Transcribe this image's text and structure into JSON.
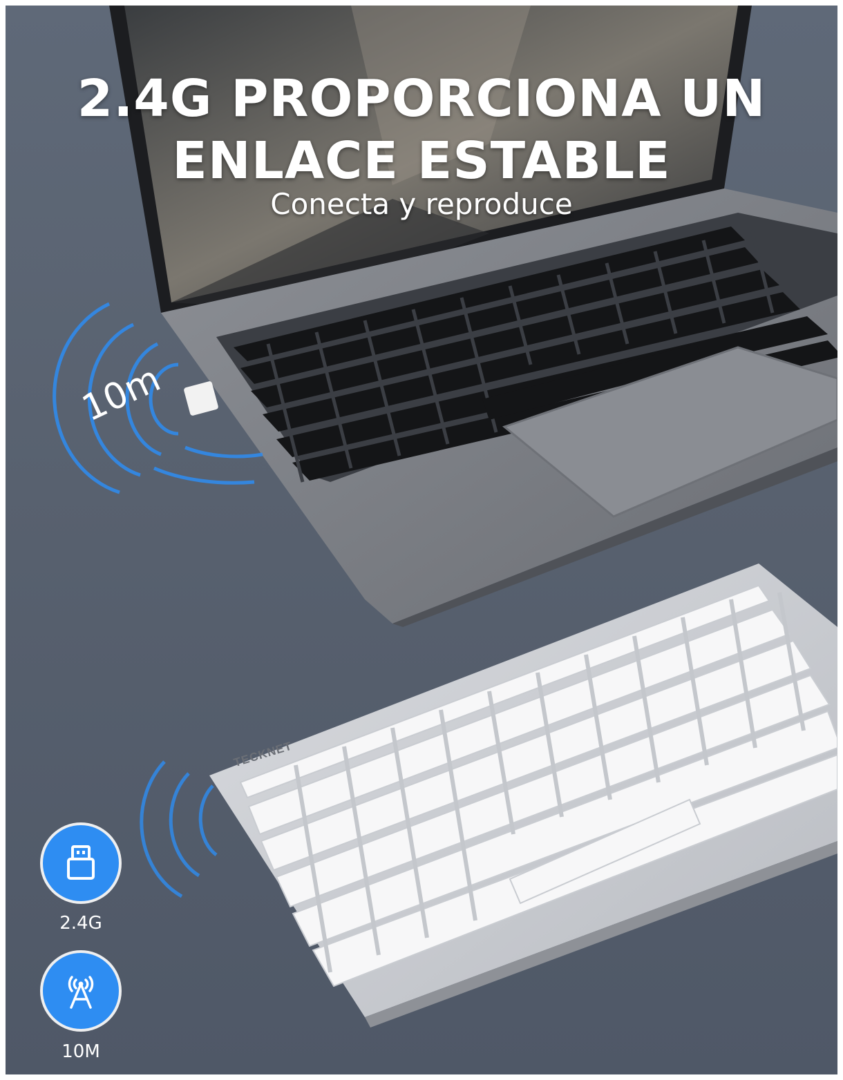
{
  "headline": {
    "line1": "2.4G PROPORCIONA UN",
    "line2": "ENLACE ESTABLE",
    "subtitle": "Conecta y reproduce"
  },
  "signal": {
    "range_label": "10m"
  },
  "keyboard": {
    "brand": "TECKNET"
  },
  "features": [
    {
      "label": "2.4G",
      "icon": "usb-dongle-icon"
    },
    {
      "label": "10M",
      "icon": "signal-tower-icon"
    }
  ],
  "colors": {
    "accent": "#2e8df2",
    "background": "#58616f"
  }
}
